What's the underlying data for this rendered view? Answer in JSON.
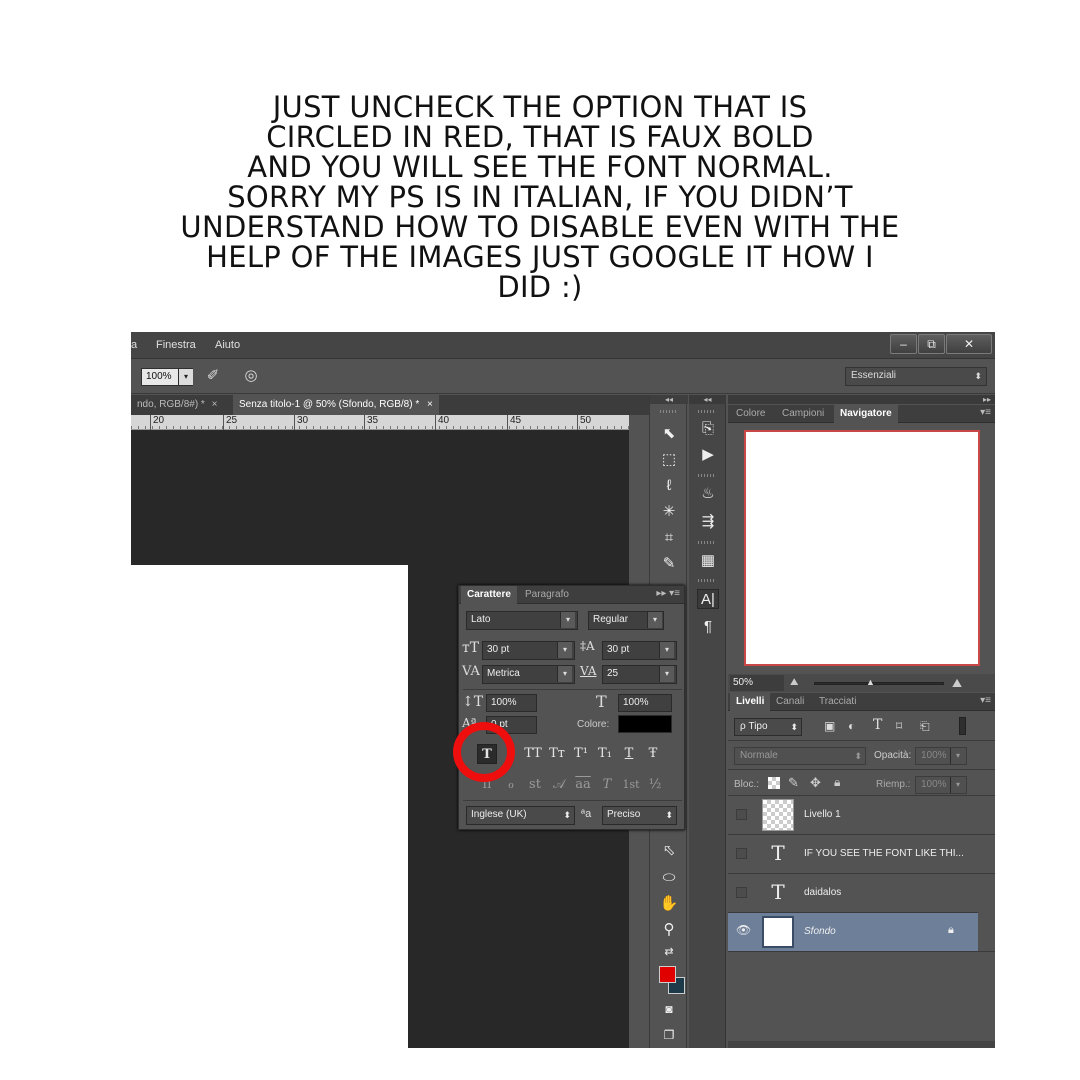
{
  "caption": {
    "lines": [
      "JUST UNCHECK THE OPTION THAT IS",
      "CIRCLED IN RED, THAT IS FAUX BOLD",
      "AND YOU WILL SEE THE FONT NORMAL.",
      "SORRY MY PS IS IN ITALIAN, IF YOU DIDN’T",
      "UNDERSTAND HOW TO DISABLE EVEN WITH THE",
      "HELP OF THE IMAGES JUST GOOGLE IT HOW I",
      "DID :)"
    ]
  },
  "menubar": {
    "items": [
      "a",
      "Finestra",
      "Aiuto"
    ],
    "window_buttons": [
      "–",
      "⧉",
      "✕"
    ]
  },
  "options": {
    "zoom": "100%",
    "workspace": "Essenziali"
  },
  "tabs": [
    {
      "label": "ndo, RGB/8#) *",
      "close": "×"
    },
    {
      "label": "Senza titolo-1 @ 50% (Sfondo, RGB/8) *",
      "close": "×"
    }
  ],
  "ruler": {
    "labels": [
      "20",
      "25",
      "30",
      "35",
      "40",
      "45",
      "50"
    ]
  },
  "character_panel": {
    "tabs": [
      "Carattere",
      "Paragrafo"
    ],
    "font_family": "Lato",
    "font_style": "Regular",
    "font_size": "30 pt",
    "leading": "30 pt",
    "kerning": "Metrica",
    "tracking": "25",
    "vertical_scale": "100%",
    "horizontal_scale": "100%",
    "baseline_shift": "0 pt",
    "color_label": "Colore:",
    "text_color": "#000000",
    "style_buttons": [
      "T",
      "TT",
      "Tт",
      "T¹",
      "T₁",
      "T",
      "Ŧ"
    ],
    "opentype_buttons": [
      "fi",
      "ℴ",
      "st",
      "𝒜",
      "aa",
      "T",
      "1st",
      "½"
    ],
    "language": "Inglese (UK)",
    "aa_label": "ªa",
    "antialias": "Preciso",
    "faux_bold_highlight": "#ee0e0e"
  },
  "right_panels": {
    "top_tabs": [
      "Colore",
      "Campioni",
      "Navigatore"
    ],
    "navigator_zoom": "50%",
    "layers_tabs": [
      "Livelli",
      "Canali",
      "Tracciati"
    ],
    "filter_kind": "ρ Tipo",
    "blend_mode": "Normale",
    "opacity_label": "Opacità:",
    "opacity": "100%",
    "lock_label": "Bloc.:",
    "fill_label": "Riemp.:",
    "fill": "100%",
    "layers": [
      {
        "name": "Livello 1",
        "kind": "pixel",
        "visible": false,
        "selected": false
      },
      {
        "name": "IF YOU SEE THE FONT LIKE THI...",
        "kind": "text",
        "visible": false,
        "selected": false
      },
      {
        "name": "daidalos",
        "kind": "text",
        "visible": false,
        "selected": false
      },
      {
        "name": "Sfondo",
        "kind": "background",
        "visible": true,
        "selected": true
      }
    ]
  },
  "colors": {
    "foreground": "#e00000",
    "background": "#1c3a4a",
    "selected_layer": "#6e7f99",
    "canvas_bg": "#282828",
    "navigator_border": "#c84848"
  }
}
